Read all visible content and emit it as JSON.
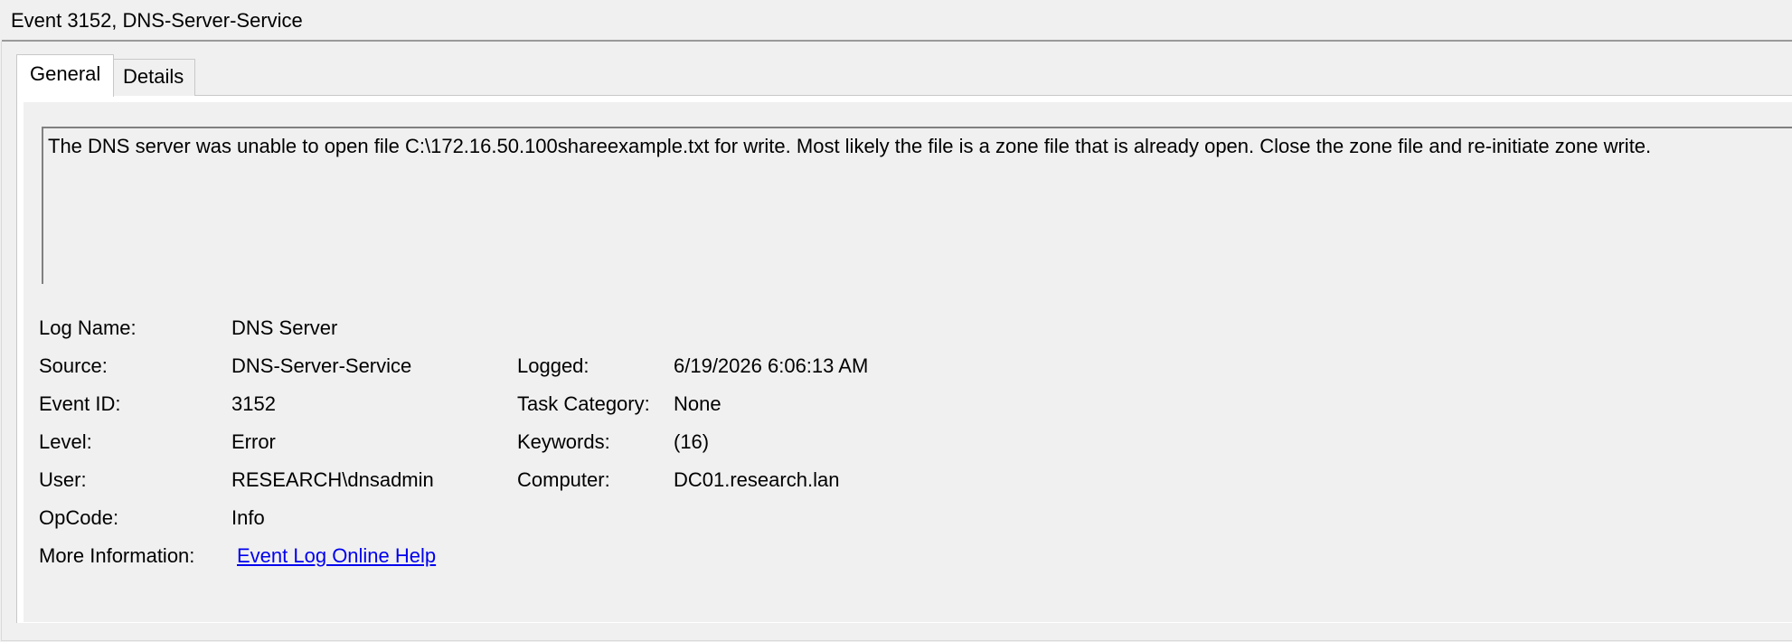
{
  "window": {
    "title": "Event 3152, DNS-Server-Service"
  },
  "tabs": [
    {
      "label": "General",
      "selected": true
    },
    {
      "label": "Details",
      "selected": false
    }
  ],
  "description": "The DNS server was unable to open file C:\\172.16.50.100shareexample.txt for write.  Most likely the file is a zone file that is already open.  Close the zone file and re-initiate zone write.",
  "fields": {
    "log_name": {
      "label": "Log Name:",
      "value": "DNS Server"
    },
    "source": {
      "label": "Source:",
      "value": "DNS-Server-Service"
    },
    "logged": {
      "label": "Logged:",
      "value": "6/19/2026 6:06:13 AM"
    },
    "event_id": {
      "label": "Event ID:",
      "value": "3152"
    },
    "task_category": {
      "label": "Task Category:",
      "value": "None"
    },
    "level": {
      "label": "Level:",
      "value": "Error"
    },
    "keywords": {
      "label": "Keywords:",
      "value": "(16)"
    },
    "user": {
      "label": "User:",
      "value": "RESEARCH\\dnsadmin"
    },
    "computer": {
      "label": "Computer:",
      "value": "DC01.research.lan"
    },
    "opcode": {
      "label": "OpCode:",
      "value": "Info"
    },
    "more_information": {
      "label": "More Information:",
      "link_text": "Event Log Online Help"
    }
  },
  "colors": {
    "background": "#f0f0f0",
    "link": "#0000ee"
  }
}
